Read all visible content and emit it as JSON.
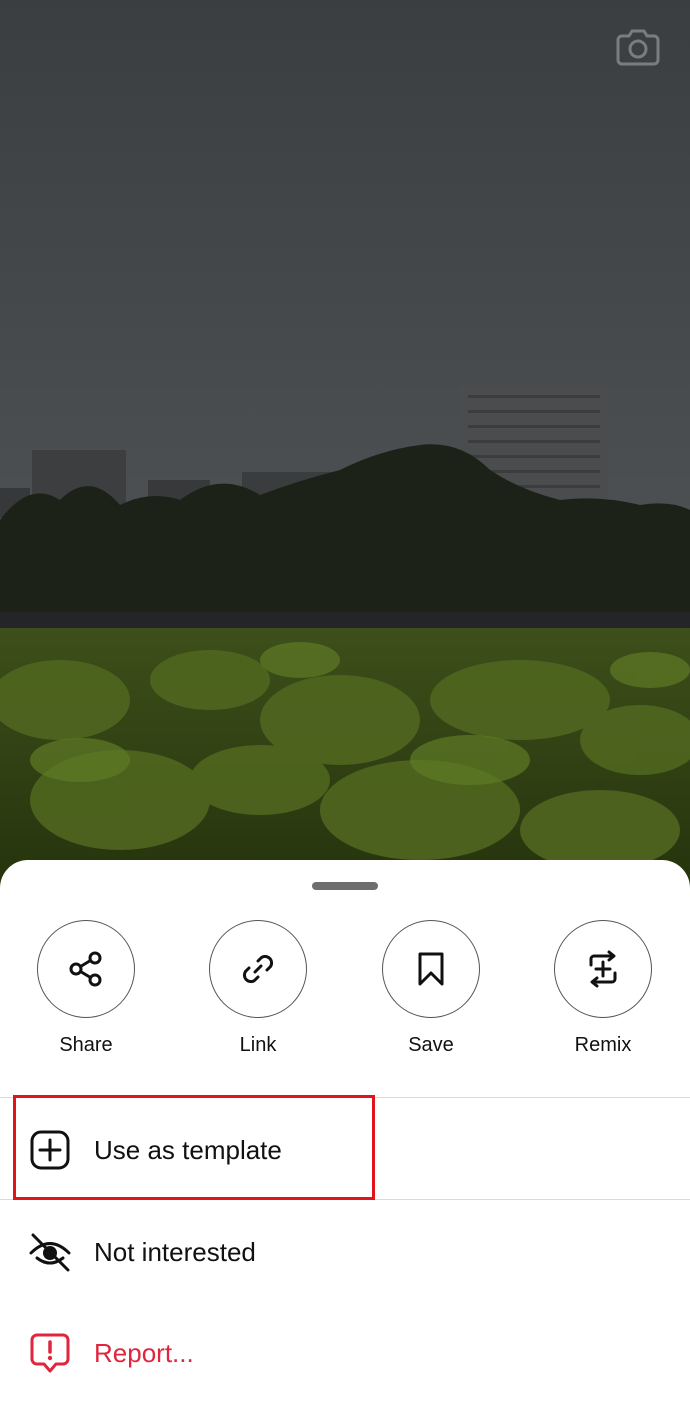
{
  "icons": {
    "camera": "camera-icon",
    "heart": "heart-icon"
  },
  "sheet": {
    "actions": [
      {
        "label": "Share",
        "icon": "share-icon"
      },
      {
        "label": "Link",
        "icon": "link-icon"
      },
      {
        "label": "Save",
        "icon": "bookmark-icon"
      },
      {
        "label": "Remix",
        "icon": "remix-icon"
      }
    ],
    "menu": [
      {
        "label": "Use as template",
        "icon": "add-square-icon"
      },
      {
        "label": "Not interested",
        "icon": "eye-off-icon"
      },
      {
        "label": "Report...",
        "icon": "report-icon"
      }
    ]
  },
  "colors": {
    "report": "#e0253d",
    "highlight": "#e3131b"
  }
}
